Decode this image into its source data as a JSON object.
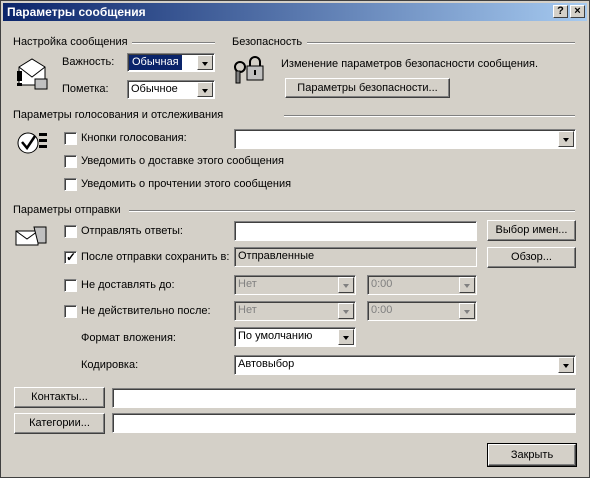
{
  "window": {
    "title": "Параметры сообщения",
    "help_btn": "?",
    "close_btn": "×"
  },
  "message_settings": {
    "group_label": "Настройка сообщения",
    "importance_label": "Важность:",
    "importance_value": "Обычная",
    "sensitivity_label": "Пометка:",
    "sensitivity_value": "Обычное"
  },
  "security": {
    "group_label": "Безопасность",
    "description": "Изменение параметров безопасности сообщения.",
    "button_label": "Параметры безопасности..."
  },
  "voting": {
    "group_label": "Параметры голосования и отслеживания",
    "voting_buttons_label": "Кнопки голосования:",
    "voting_buttons_value": "",
    "delivery_receipt_label": "Уведомить о доставке этого сообщения",
    "read_receipt_label": "Уведомить о прочтении этого сообщения"
  },
  "delivery": {
    "group_label": "Параметры отправки",
    "reply_to_label": "Отправлять ответы:",
    "reply_to_value": "",
    "select_names_label": "Выбор имен...",
    "save_sent_label": "После отправки сохранить в:",
    "save_sent_value": "Отправленные",
    "browse_label": "Обзор...",
    "no_deliver_label": "Не доставлять до:",
    "no_deliver_date": "Нет",
    "no_deliver_time": "0:00",
    "expires_label": "Не действительно после:",
    "expires_date": "Нет",
    "expires_time": "0:00",
    "attachment_format_label": "Формат вложения:",
    "attachment_format_value": "По умолчанию",
    "encoding_label": "Кодировка:",
    "encoding_value": "Автовыбор"
  },
  "footer": {
    "contacts_label": "Контакты...",
    "contacts_value": "",
    "categories_label": "Категории...",
    "categories_value": "",
    "close_label": "Закрыть"
  }
}
